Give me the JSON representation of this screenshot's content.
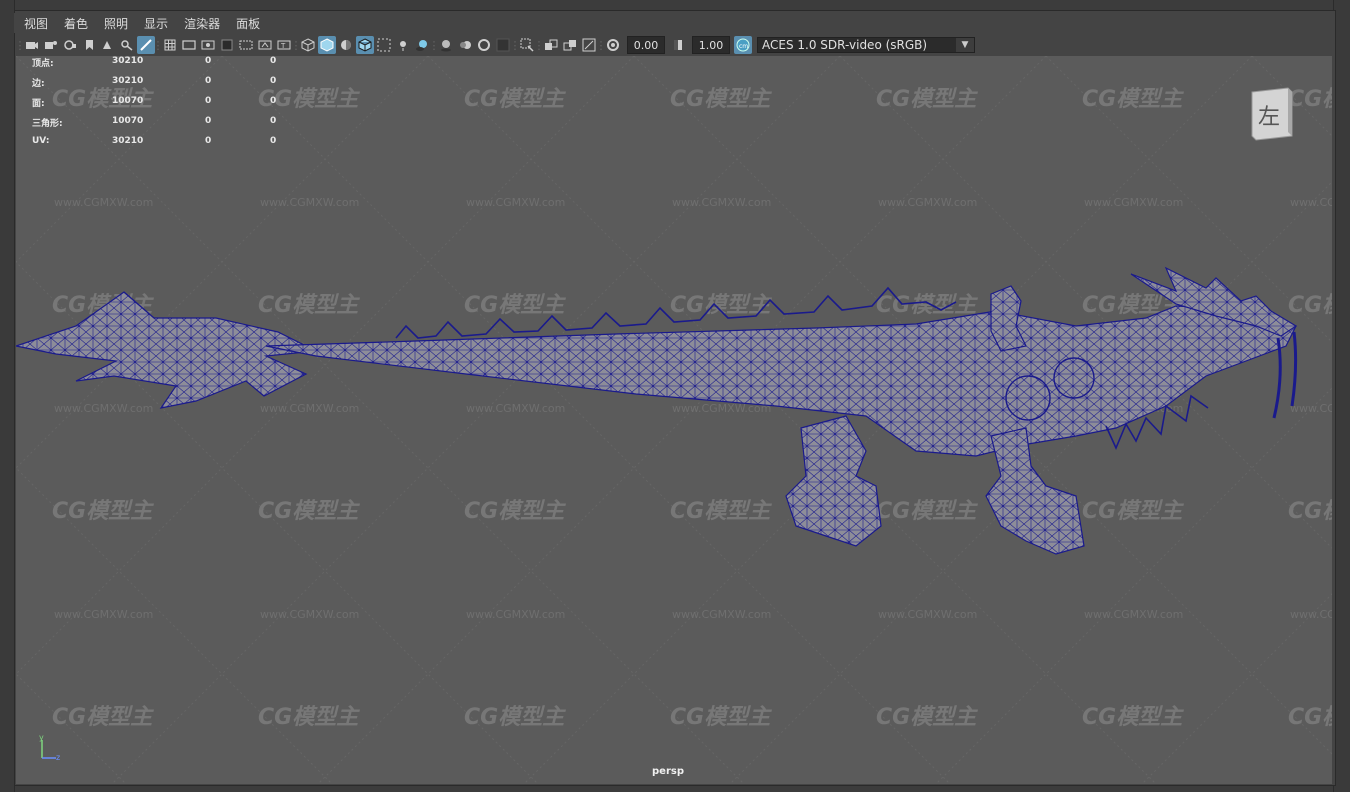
{
  "menubar": {
    "items": [
      "视图",
      "着色",
      "照明",
      "显示",
      "渲染器",
      "面板"
    ]
  },
  "toolbar": {
    "exposure_value": "0.00",
    "gamma_value": "1.00",
    "colorspace": "ACES 1.0 SDR-video (sRGB)",
    "icons": [
      "select-camera-icon",
      "camera-attributes-icon",
      "bookmark-icon",
      "image-plane-icon",
      "grease-pencil-icon",
      "2d-pan-zoom-icon",
      "grid-icon",
      "film-gate-icon",
      "resolution-gate-icon",
      "gate-mask-icon",
      "field-chart-icon",
      "safe-action-icon",
      "safe-title-icon",
      "wireframe-icon",
      "smooth-shade-icon",
      "default-material-icon",
      "wireframe-on-shaded-icon",
      "xray-icon",
      "use-all-lights-icon",
      "shadows-icon",
      "ambient-occlusion-icon",
      "motion-blur-icon",
      "multisample-aa-icon",
      "depth-of-field-icon",
      "isolate-select-icon",
      "xray-joints-icon",
      "xray-active-icon",
      "backface-culling-icon",
      "exposure-icon",
      "gamma-icon",
      "color-management-icon"
    ]
  },
  "hud": {
    "rows": [
      {
        "label": "顶点:",
        "v1": "30210",
        "v2": "0",
        "v3": "0"
      },
      {
        "label": "边:",
        "v1": "30210",
        "v2": "0",
        "v3": "0"
      },
      {
        "label": "面:",
        "v1": "10070",
        "v2": "0",
        "v3": "0"
      },
      {
        "label": "三角形:",
        "v1": "10070",
        "v2": "0",
        "v3": "0"
      },
      {
        "label": "UV:",
        "v1": "30210",
        "v2": "0",
        "v3": "0"
      }
    ]
  },
  "viewcube": {
    "label": "左"
  },
  "camera": {
    "label": "persp"
  },
  "axis": {
    "y": "y",
    "z": "z"
  },
  "watermark": {
    "logo": "CG模型主",
    "url": "www.CGMXW.com"
  },
  "colors": {
    "viewport_bg": "#5b5b5b",
    "wire": "#1a1a8c",
    "model_fill": "#8a8a96",
    "accent": "#5a8fb0"
  }
}
